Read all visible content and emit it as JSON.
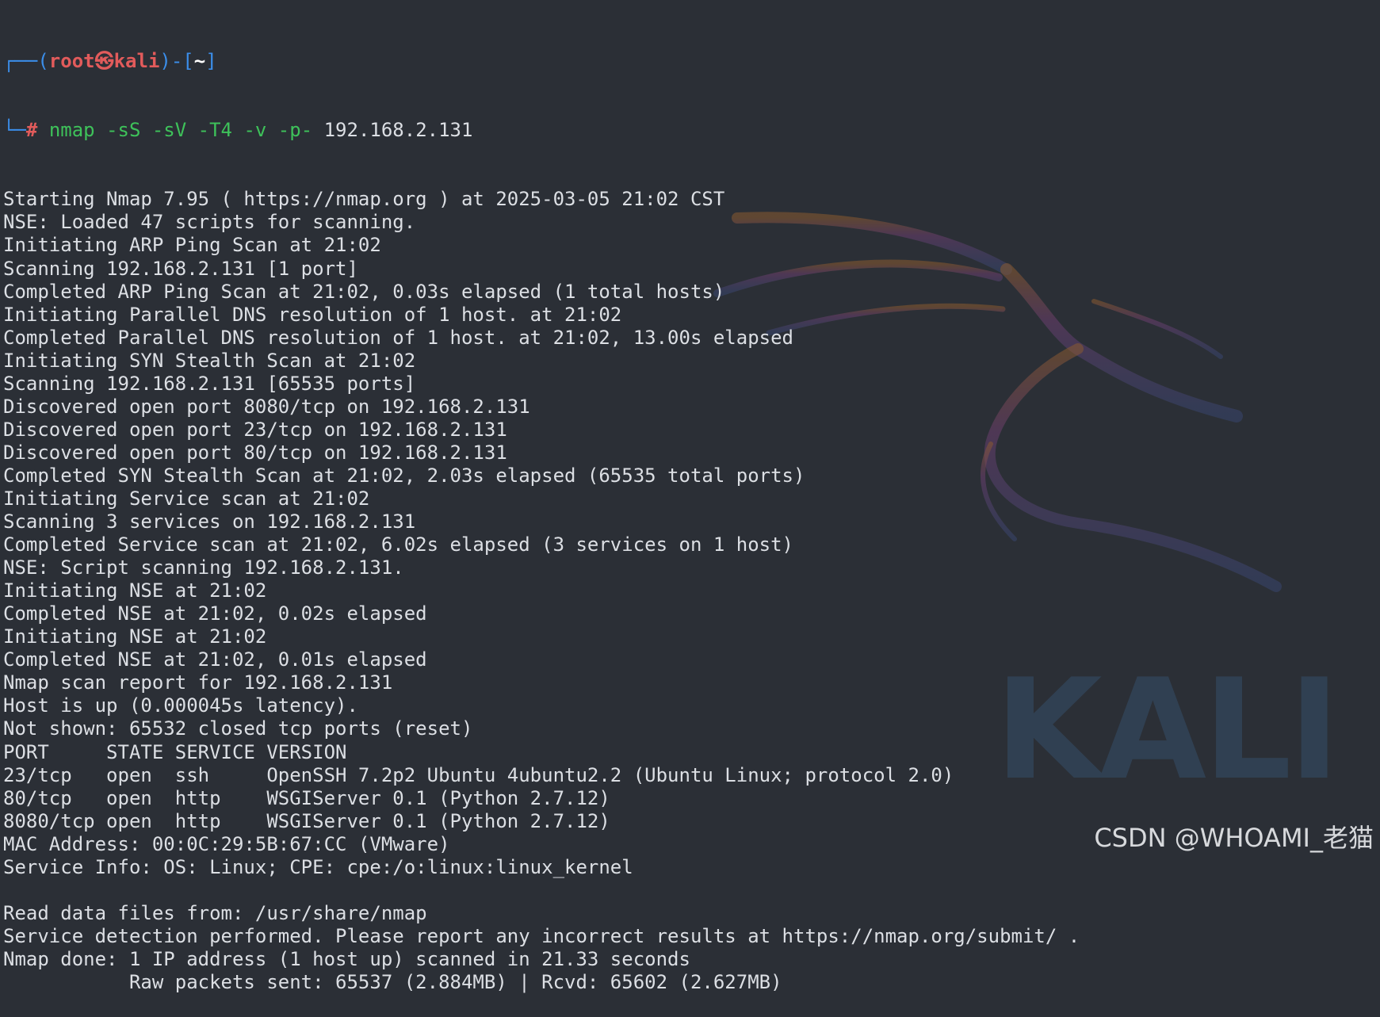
{
  "prompt": {
    "user": "root",
    "separator_symbol": "㉿",
    "host": "kali",
    "dir": "~",
    "symbol": "#",
    "command": "nmap",
    "options": "-sS -sV -T4 -v -p-",
    "target": "192.168.2.131"
  },
  "output": [
    "Starting Nmap 7.95 ( https://nmap.org ) at 2025-03-05 21:02 CST",
    "NSE: Loaded 47 scripts for scanning.",
    "Initiating ARP Ping Scan at 21:02",
    "Scanning 192.168.2.131 [1 port]",
    "Completed ARP Ping Scan at 21:02, 0.03s elapsed (1 total hosts)",
    "Initiating Parallel DNS resolution of 1 host. at 21:02",
    "Completed Parallel DNS resolution of 1 host. at 21:02, 13.00s elapsed",
    "Initiating SYN Stealth Scan at 21:02",
    "Scanning 192.168.2.131 [65535 ports]",
    "Discovered open port 8080/tcp on 192.168.2.131",
    "Discovered open port 23/tcp on 192.168.2.131",
    "Discovered open port 80/tcp on 192.168.2.131",
    "Completed SYN Stealth Scan at 21:02, 2.03s elapsed (65535 total ports)",
    "Initiating Service scan at 21:02",
    "Scanning 3 services on 192.168.2.131",
    "Completed Service scan at 21:02, 6.02s elapsed (3 services on 1 host)",
    "NSE: Script scanning 192.168.2.131.",
    "Initiating NSE at 21:02",
    "Completed NSE at 21:02, 0.02s elapsed",
    "Initiating NSE at 21:02",
    "Completed NSE at 21:02, 0.01s elapsed",
    "Nmap scan report for 192.168.2.131",
    "Host is up (0.000045s latency).",
    "Not shown: 65532 closed tcp ports (reset)",
    "PORT     STATE SERVICE VERSION",
    "23/tcp   open  ssh     OpenSSH 7.2p2 Ubuntu 4ubuntu2.2 (Ubuntu Linux; protocol 2.0)",
    "80/tcp   open  http    WSGIServer 0.1 (Python 2.7.12)",
    "8080/tcp open  http    WSGIServer 0.1 (Python 2.7.12)",
    "MAC Address: 00:0C:29:5B:67:CC (VMware)",
    "Service Info: OS: Linux; CPE: cpe:/o:linux:linux_kernel",
    "",
    "Read data files from: /usr/share/nmap",
    "Service detection performed. Please report any incorrect results at https://nmap.org/submit/ .",
    "Nmap done: 1 IP address (1 host up) scanned in 21.33 seconds",
    "           Raw packets sent: 65537 (2.884MB) | Rcvd: 65602 (2.627MB)"
  ],
  "wallpaper": {
    "logo_text": "KALI"
  },
  "watermark": "CSDN @WHOAMI_老猫",
  "colors": {
    "background": "#2b2f36",
    "text": "#dcdfe4",
    "prompt_frame": "#3b8eea",
    "prompt_root": "#e25b5b",
    "command": "#3ec25a"
  }
}
